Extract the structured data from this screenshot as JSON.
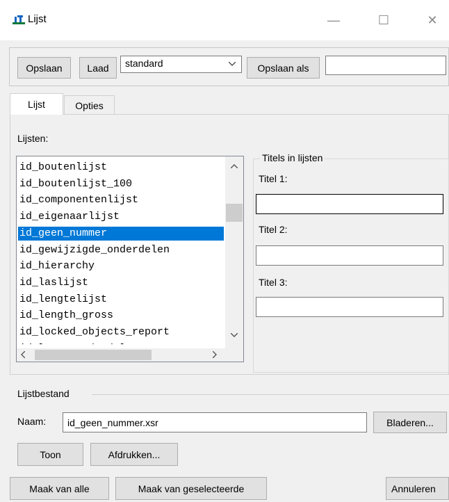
{
  "window": {
    "title": "Lijst",
    "minimize_glyph": "—",
    "maximize_glyph": "☐",
    "close_glyph": "✕"
  },
  "toolbar": {
    "save_label": "Opslaan",
    "load_label": "Laad",
    "preset_value": "standard",
    "save_as_label": "Opslaan als",
    "save_as_value": ""
  },
  "tabs": [
    {
      "label": "Lijst",
      "active": true
    },
    {
      "label": "Opties",
      "active": false
    }
  ],
  "lists": {
    "label": "Lijsten:",
    "items": [
      "id_boutenlijst",
      "id_boutenlijst_100",
      "id_componentenlijst",
      "id_eigenaarlijst",
      "id_geen_nummer",
      "id_gewijzigde_onderdelen",
      "id_hierarchy",
      "id_laslijst",
      "id_lengtelijst",
      "id_length_gross",
      "id_locked_objects_report",
      "id_losse_onderdelen"
    ],
    "selected_index": 4
  },
  "titles": {
    "group_label": "Titels in lijsten",
    "title1_label": "Titel 1:",
    "title1_value": "",
    "title2_label": "Titel 2:",
    "title2_value": "",
    "title3_label": "Titel 3:",
    "title3_value": ""
  },
  "list_file": {
    "group_label": "Lijstbestand",
    "name_label": "Naam:",
    "name_value": "id_geen_nummer.xsr",
    "browse_label": "Bladeren...",
    "show_label": "Toon",
    "print_label": "Afdrukken..."
  },
  "footer": {
    "make_all_label": "Maak van alle",
    "make_selected_label": "Maak van geselecteerde",
    "cancel_label": "Annuleren"
  },
  "colors": {
    "selection": "#0078d7",
    "window_bg": "#f0f0f0"
  }
}
